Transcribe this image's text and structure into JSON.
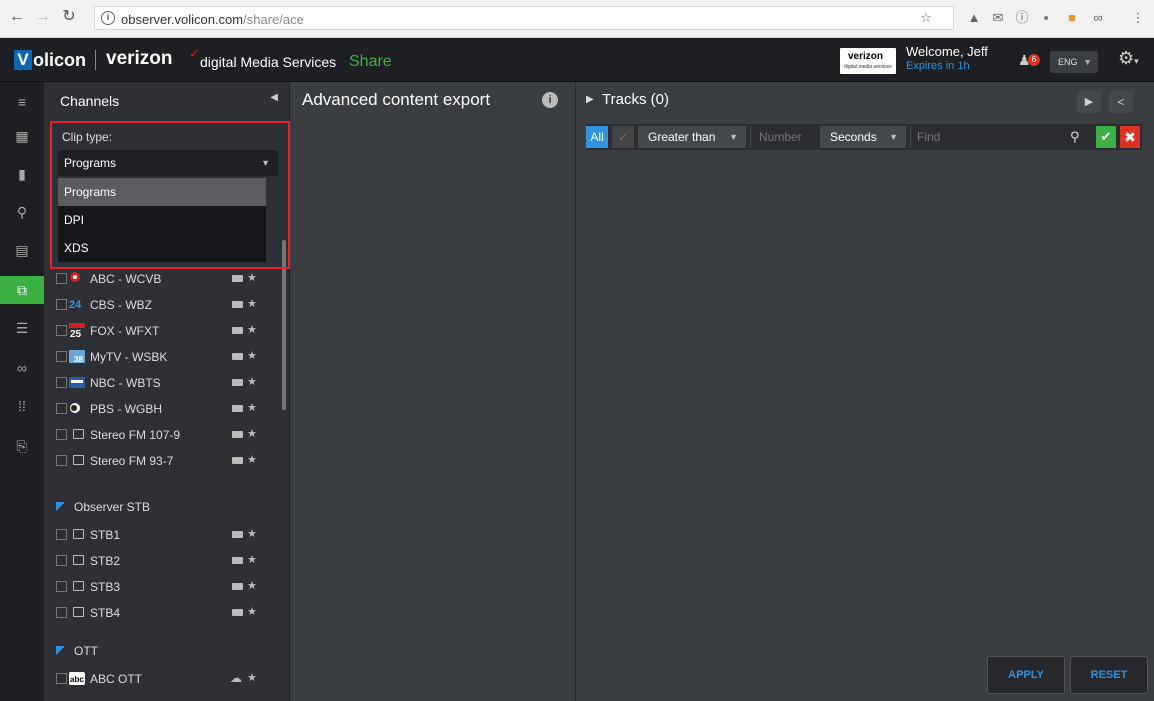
{
  "browser": {
    "url_host": "observer.volicon.com",
    "url_path": "/share/ace"
  },
  "header": {
    "logo_mark": "V",
    "logo_text": "olicon",
    "brand": "verizon",
    "brand_suffix": "digital Media Services",
    "product": "Share",
    "badge_line1": "verizon",
    "badge_line2": "digital media services",
    "welcome": "Welcome, Jeff",
    "expires": "Expires in 1h",
    "notifications": "6",
    "language": "ENG",
    "accent": "#3cb043",
    "link_color": "#2f93e0"
  },
  "channels": {
    "title": "Channels",
    "clip_type_label": "Clip type:",
    "clip_type_value": "Programs",
    "options": [
      "Programs",
      "DPI",
      "XDS"
    ],
    "items": [
      {
        "name": "ABC - WCVB"
      },
      {
        "name": "CBS - WBZ"
      },
      {
        "name": "FOX - WFXT"
      },
      {
        "name": "MyTV - WSBK"
      },
      {
        "name": "NBC - WBTS"
      },
      {
        "name": "PBS - WGBH"
      },
      {
        "name": "Stereo FM 107-9"
      },
      {
        "name": "Stereo FM 93-7"
      }
    ],
    "groups": [
      {
        "name": "Observer STB",
        "items": [
          "STB1",
          "STB2",
          "STB3",
          "STB4"
        ]
      },
      {
        "name": "OTT",
        "items": [
          "ABC OTT"
        ]
      }
    ]
  },
  "middle": {
    "title": "Advanced content export"
  },
  "tracks": {
    "title": "Tracks (0)",
    "all_label": "All",
    "comparator": "Greater than",
    "number_placeholder": "Number",
    "unit": "Seconds",
    "find_placeholder": "Find",
    "apply_label": "APPLY",
    "reset_label": "RESET"
  }
}
